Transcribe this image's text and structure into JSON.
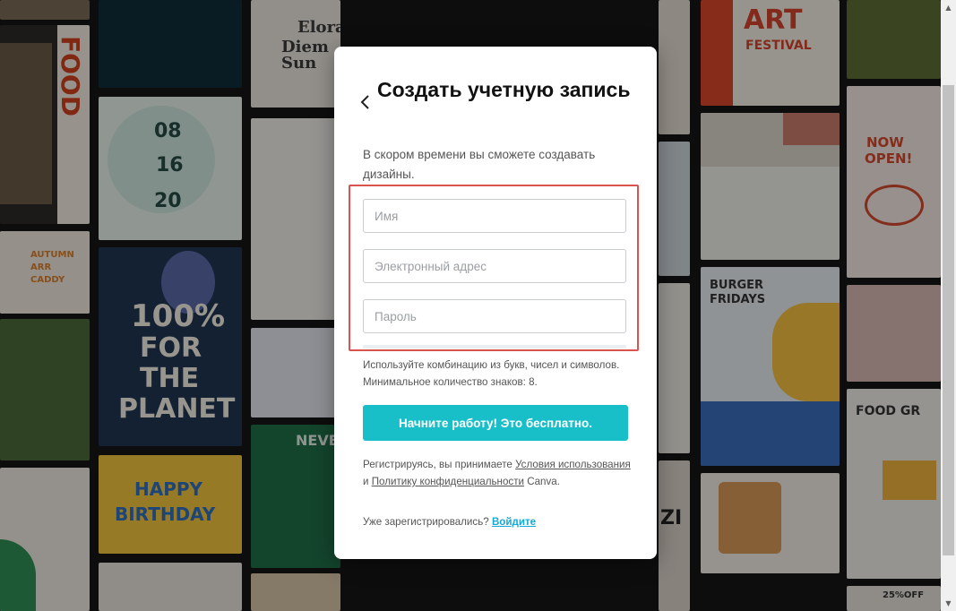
{
  "signup": {
    "title": "Создать учетную запись",
    "subtitle": "В скором времени вы сможете создавать дизайны.",
    "name_placeholder": "Имя",
    "email_placeholder": "Электронный адрес",
    "password_placeholder": "Пароль",
    "password_hint": "Используйте комбинацию из букв, чисел и символов. Минимальное количество знаков: 8.",
    "submit_label": "Начните работу! Это бесплатно.",
    "legal_prefix": "Регистрируясь, вы принимаете",
    "terms_link": "Условия использования",
    "legal_and": "и",
    "privacy_link": "Политику конфиденциальности",
    "legal_suffix": "Canva.",
    "signin_prefix": "Уже зарегистрировались?",
    "signin_link": "Войдите"
  },
  "background": {
    "tile_texts": [
      "Elora",
      "Diem Sun",
      "ART",
      "FESTIVAL",
      "FOOD",
      "08",
      "16",
      "20",
      "NOW",
      "OPEN!",
      "AUTUMN",
      "ARR",
      "CADDY",
      "100%",
      "FOR",
      "THE",
      "PLANET",
      "BURGER",
      "FRIDAYS",
      "25%OFF",
      "FOOD GR",
      "HAPPY",
      "BIRTHDAY",
      "NEVER",
      "ZI"
    ]
  },
  "colors": {
    "accent": "#18bfc8",
    "link": "#18a8d8",
    "highlight_border": "#d9534f"
  }
}
